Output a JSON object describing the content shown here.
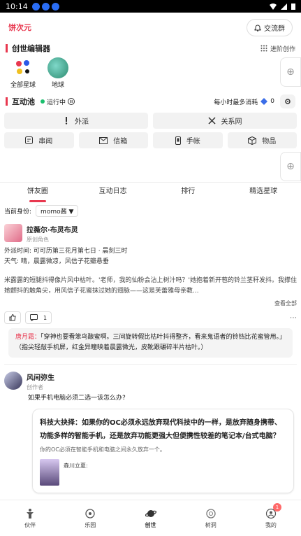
{
  "status_bar": {
    "time": "10:14"
  },
  "header": {
    "brand": "饼次元",
    "chat_label": "交流群"
  },
  "creator": {
    "title": "创世编辑器",
    "advanced_label": "进阶创作"
  },
  "planets": [
    {
      "name": "全部星球"
    },
    {
      "name": "地球"
    }
  ],
  "pool": {
    "title": "互动池",
    "status": "运行中",
    "limit_label": "每小时最多消耗",
    "count": "0"
  },
  "pool_buttons_row1": [
    {
      "label": "外派",
      "icon": "pin-icon"
    },
    {
      "label": "关系网",
      "icon": "relation-icon"
    }
  ],
  "pool_buttons_row2": [
    {
      "label": "串闻",
      "icon": "news-icon"
    },
    {
      "label": "信箱",
      "icon": "mail-icon"
    },
    {
      "label": "手帐",
      "icon": "phone-icon"
    },
    {
      "label": "物品",
      "icon": "box-icon"
    }
  ],
  "tabs": [
    "饼友圈",
    "互动日志",
    "排行",
    "精选星球"
  ],
  "identity": {
    "label": "当前身份:",
    "value": "momo酱 ▼"
  },
  "post1": {
    "author": "拉薇尔·布灵布灵",
    "subtitle": "原创角色",
    "line1": "外派时间: 可可历第三花月第七日 · 晨刻三时",
    "line2": "天气: 晴，晨露微凉，风信子花瓣悬垂",
    "line3": "米露露的短腿抖得像片风中枯叶。'老师，我的仙粉会沾上树汁吗？'她抱着新开苞的铃兰茎秆发抖。我撑住她颤抖的触角尖，用风信子花蜜抹过她的翅脉——这是芙蕾雅母亲教...",
    "more": "查看全部",
    "comment_count": "1",
    "comment_author": "唐月霜：",
    "comment_text": "「穿神也要看笨鸟酿蜜啊。三间旋转假比枯叶抖得整齐，看来鬼语者的铃铛比花蜜管用。」（指尖轻敲手机屏，红金异瞳映着晨露微光，皮靴跟碾碎半片枯叶。）"
  },
  "post2": {
    "author": "风间弥生",
    "subtitle": "创作者",
    "question": "如果手机电脑必须二选一该怎么办?",
    "card_title": "科技大抉择：如果你的OC必须永远放弃现代科技中的一样，是放弃随身携带、功能多样的智能手机，还是放弃功能更强大但便携性较差的笔记本/台式电脑？",
    "card_desc": "你的OC必须在智能手机和电脑之间永久放弃一个。",
    "card_user": "森川立夏:"
  },
  "bottom_nav": [
    {
      "label": "伙伴",
      "icon": "partner-icon"
    },
    {
      "label": "乐园",
      "icon": "park-icon"
    },
    {
      "label": "创世",
      "icon": "planet-icon"
    },
    {
      "label": "树洞",
      "icon": "treehole-icon"
    },
    {
      "label": "我的",
      "icon": "profile-icon",
      "badge": "1"
    }
  ],
  "colors": {
    "accent": "#e8384f",
    "running": "#1bbf6e"
  }
}
